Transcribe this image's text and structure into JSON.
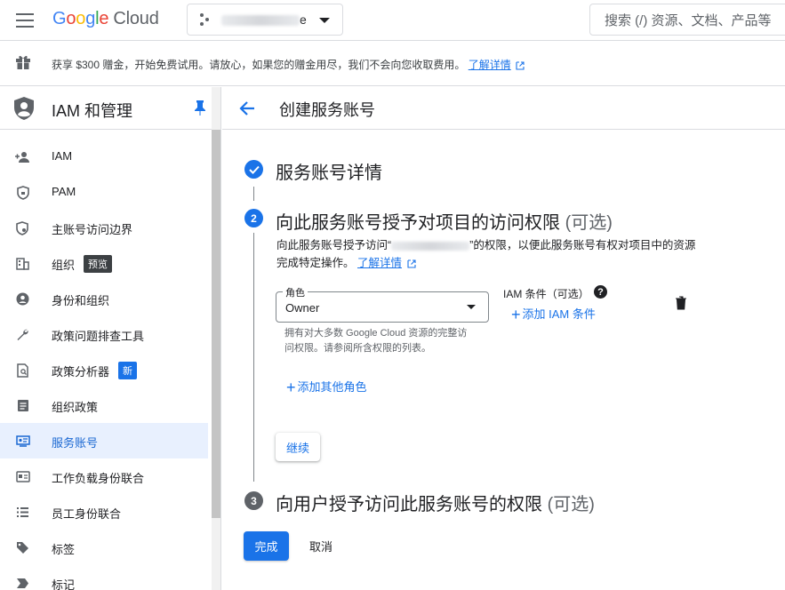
{
  "topbar": {
    "logo_letters": [
      "G",
      "o",
      "o",
      "g",
      "l",
      "e"
    ],
    "logo_suffix": "Cloud",
    "project_name_suffix": "e",
    "search_placeholder": "搜索 (/) 资源、文档、产品等"
  },
  "promo": {
    "text": "获享 $300 赠金，开始免费试用。请放心，如果您的赠金用尽，我们不会向您收取费用。",
    "link": "了解详情"
  },
  "sidebar": {
    "title": "IAM 和管理",
    "items": [
      {
        "label": "IAM",
        "icon": "person-add-icon"
      },
      {
        "label": "PAM",
        "icon": "shield-lock-icon"
      },
      {
        "label": "主账号访问边界",
        "icon": "policy-icon"
      },
      {
        "label": "组织",
        "icon": "domain-icon",
        "badge": "预览"
      },
      {
        "label": "身份和组织",
        "icon": "account-circle-icon"
      },
      {
        "label": "政策问题排查工具",
        "icon": "wrench-icon"
      },
      {
        "label": "政策分析器",
        "icon": "document-search-icon",
        "badge": "新"
      },
      {
        "label": "组织政策",
        "icon": "list-document-icon"
      },
      {
        "label": "服务账号",
        "icon": "service-account-icon",
        "active": true
      },
      {
        "label": "工作负载身份联合",
        "icon": "id-card-icon"
      },
      {
        "label": "员工身份联合",
        "icon": "list-icon"
      },
      {
        "label": "标签",
        "icon": "tag-icon"
      },
      {
        "label": "标记",
        "icon": "label-icon"
      }
    ]
  },
  "main": {
    "title": "创建服务账号",
    "step1": {
      "title": "服务账号详情"
    },
    "step2": {
      "number": "2",
      "title": "向此服务账号授予对项目的访问权限",
      "optional": "(可选)",
      "desc_prefix": "向此服务账号授予访问“",
      "desc_suffix": "”的权限，以便此服务账号有权对项目中的资源完成特定操作。",
      "desc_link": "了解详情",
      "role_label": "角色",
      "role_value": "Owner",
      "role_help": "拥有对大多数 Google Cloud 资源的完整访问权限。请参阅所含权限的列表。",
      "iam_condition_label": "IAM 条件（可选）",
      "add_condition": "添加 IAM 条件",
      "add_role": "添加其他角色",
      "continue": "继续"
    },
    "step3": {
      "number": "3",
      "title": "向用户授予访问此服务账号的权限",
      "optional": "(可选)"
    },
    "done": "完成",
    "cancel": "取消"
  },
  "colors": {
    "primary": "#1a73e8",
    "active_bg": "#e8f0fe",
    "text": "#202124",
    "muted": "#5f6368"
  }
}
